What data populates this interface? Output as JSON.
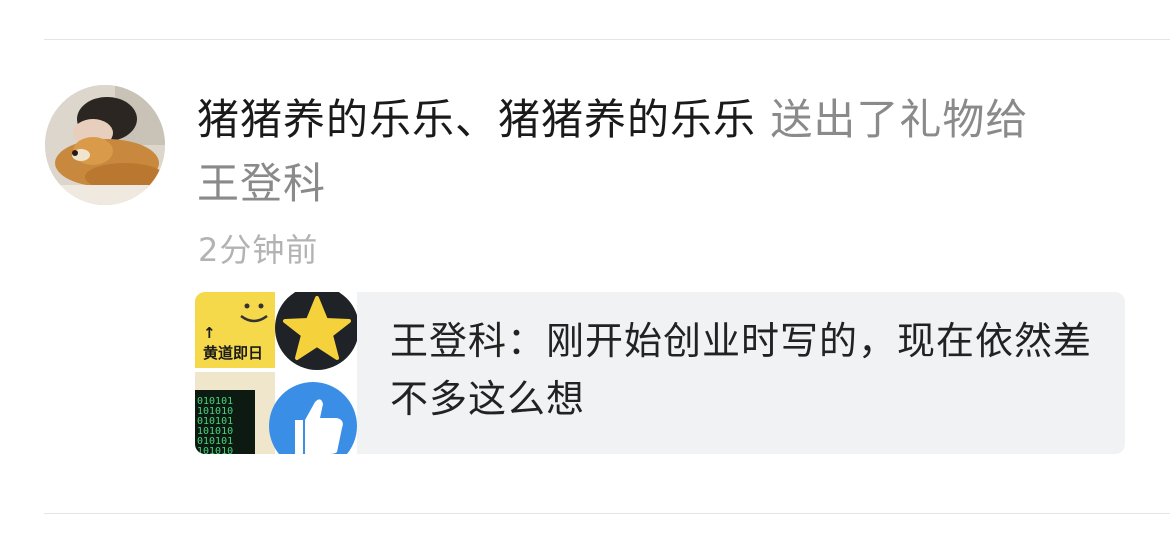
{
  "notification": {
    "sender": "猪猪养的乐乐、猪猪养的乐乐",
    "action": " 送出了礼物给",
    "target": "王登科",
    "time": "2分钟前"
  },
  "quote": {
    "text": "王登科：刚开始创业时写的，现在依然差不多这么想",
    "thumbnail_label": "黄道即日",
    "thumbnail_arrow": "↑",
    "thumbnail_binary": [
      "010101",
      "101010",
      "010101",
      "101010",
      "010101",
      "101010"
    ]
  },
  "colors": {
    "divider": "#e5e5e5",
    "card_bg": "#f1f2f4",
    "muted_text": "#8a8a8a",
    "time_text": "#b3b3b3",
    "star_yellow": "#f5d23c",
    "thumb_blue": "#3a8ee6"
  },
  "icons": [
    "avatar-photo",
    "smiley-icon",
    "star-icon",
    "thumbs-up-icon",
    "terminal-icon"
  ]
}
